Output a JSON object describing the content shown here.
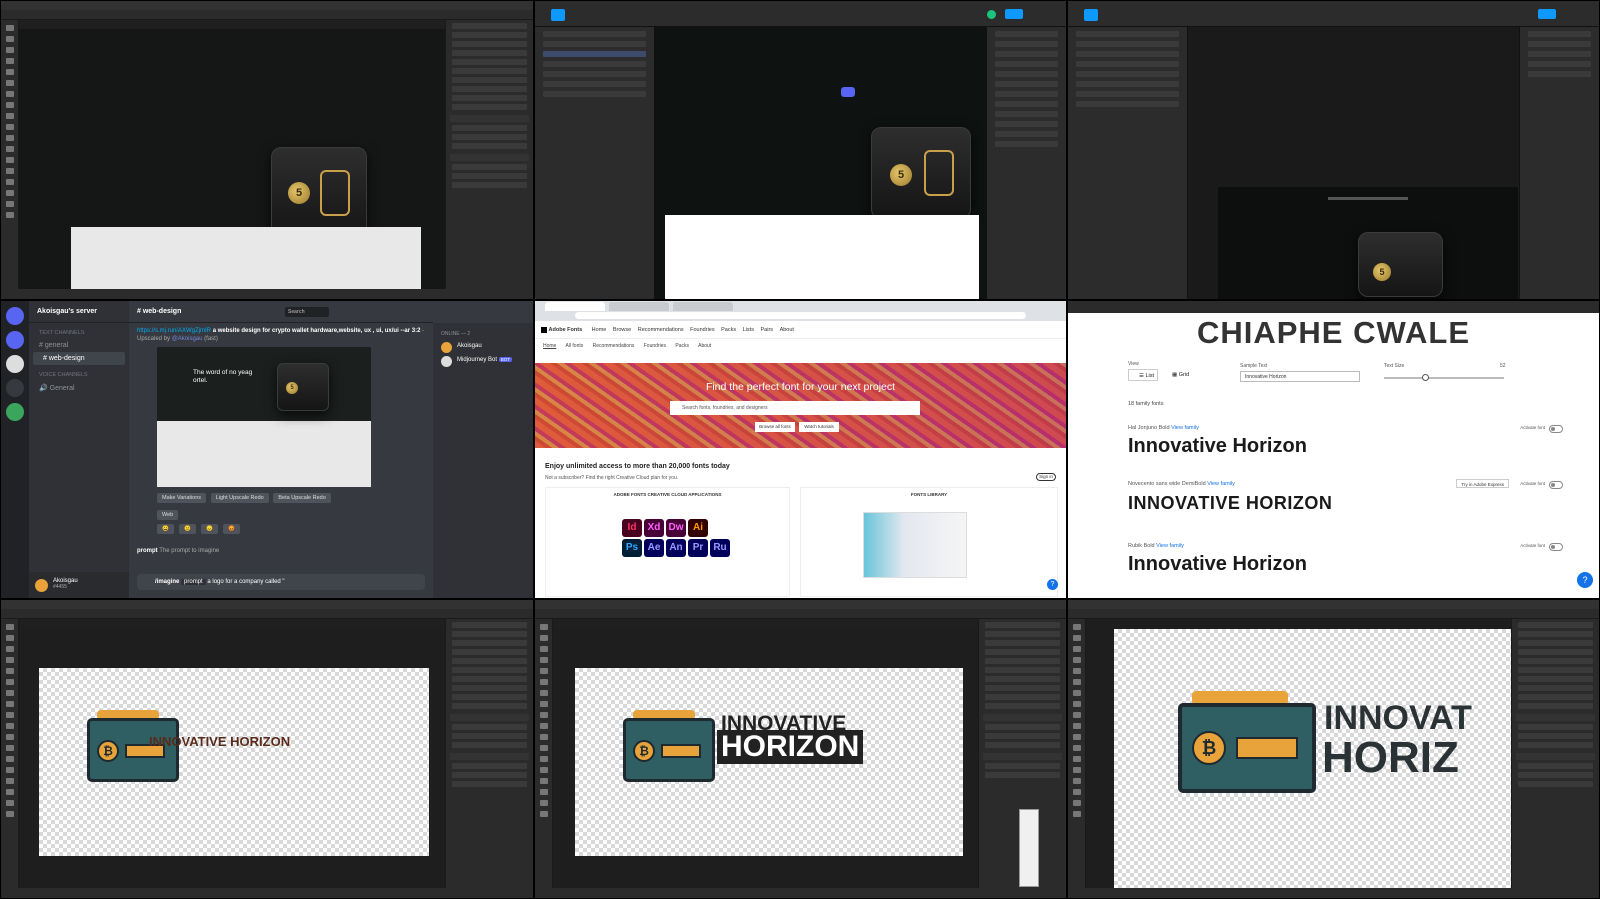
{
  "discord": {
    "server_name": "Akoisgau's server",
    "text_channels_category": "TEXT CHANNELS",
    "channels": [
      "general",
      "web-design"
    ],
    "voice_channels_category": "VOICE CHANNELS",
    "voice_channel": "General",
    "header_channel": "web-design",
    "search_placeholder": "Search",
    "message_link": "https://s.mj.run/AXWgZjmIR",
    "message_text": "a website design for crypto wallet hardware,website, ux , ui, ux/ui --ar 3:2",
    "upscaled_by": "- Upscaled by",
    "mention": "@Akoisgau",
    "speed": "(fast)",
    "preview_heading": "The word of no yeag ortel.",
    "btn_make_variations": "Make Variations",
    "btn_light_upscale": "Light Upscale Redo",
    "btn_beta_upscale": "Beta Upscale Redo",
    "btn_web": "Web",
    "prompt_label": "prompt",
    "prompt_hint": "The prompt to imagine",
    "command": "/imagine",
    "command_prompt": "prompt",
    "command_value": "a logo for a company called \"",
    "members_header": "ONLINE — 2",
    "member_1": "Akoisgau",
    "member_2": "Midjourney Bot",
    "bot_tag": "BOT",
    "user_name": "Akoisgau",
    "user_tag": "#4455"
  },
  "adobe_fonts": {
    "brand": "Adobe Fonts",
    "nav": [
      "Home",
      "Browse",
      "Recommendations",
      "Foundries",
      "Packs",
      "Lists",
      "Pairs",
      "About"
    ],
    "subnav": [
      "Home",
      "All fonts",
      "Recommendations",
      "Foundries",
      "Packs",
      "About"
    ],
    "hero_title": "Find the perfect font for your next project",
    "search_placeholder": "Search fonts, foundries, and designers",
    "hero_btn_1": "Browse all fonts",
    "hero_btn_2": "Watch tutorials",
    "promo_title": "Enjoy unlimited access to more than 20,000 fonts today",
    "promo_sub": "Not a subscriber? Find the right Creative Cloud plan for you.",
    "sign_in": "Sign in",
    "card1_title": "ADOBE FONTS CREATIVE CLOUD APPLICATIONS",
    "card2_title": "FONTS LIBRARY",
    "app_icons": [
      {
        "label": "Id",
        "bg": "#49021f",
        "fg": "#ff3366"
      },
      {
        "label": "Xd",
        "bg": "#470137",
        "fg": "#ff61f6"
      },
      {
        "label": "Dw",
        "bg": "#470137",
        "fg": "#ff61f6"
      },
      {
        "label": "Ai",
        "bg": "#330000",
        "fg": "#ff9a00"
      },
      {
        "label": "Ps",
        "bg": "#001e36",
        "fg": "#31a8ff"
      },
      {
        "label": "Ae",
        "bg": "#00005b",
        "fg": "#9999ff"
      },
      {
        "label": "An",
        "bg": "#00005b",
        "fg": "#9999ff"
      },
      {
        "label": "Pr",
        "bg": "#00005b",
        "fg": "#9999ff"
      },
      {
        "label": "Ru",
        "bg": "#00005b",
        "fg": "#9999ff"
      }
    ]
  },
  "font_list": {
    "preview_header": "CHIAPHE CWALE",
    "view_label": "View",
    "view_list": "List",
    "view_grid": "Grid",
    "sample_text_label": "Sample Text",
    "sample_text_value": "Innovative Horizon",
    "text_size_label": "Text Size",
    "text_size_value": "52",
    "family_count": "18 family fonts",
    "view_family": "View family",
    "activate_font": "Activate font",
    "try_express": "Try in Adobe Express",
    "fonts": [
      {
        "name": "Hal Jonjuno Bold",
        "sample": "Innovative Horizon"
      },
      {
        "name": "Novecento sans wide DemiBold",
        "sample": "INNOVATIVE HORIZON"
      },
      {
        "name": "Rubik Bold",
        "sample": "Innovative Horizon"
      }
    ]
  },
  "logos": {
    "text_small": "INNOVATIVE HORIZON",
    "text_line1": "INNOVATIVE",
    "text_line2": "HORIZON",
    "text_partial_1": "INNOVAT",
    "text_partial_2": "HORIZ"
  },
  "colors": {
    "logo_teal": "#2f5f63",
    "logo_orange": "#e8a33a",
    "logo_dark": "#1e2a30",
    "figma_blue": "#0d99ff",
    "discord_blurple": "#5865f2"
  }
}
